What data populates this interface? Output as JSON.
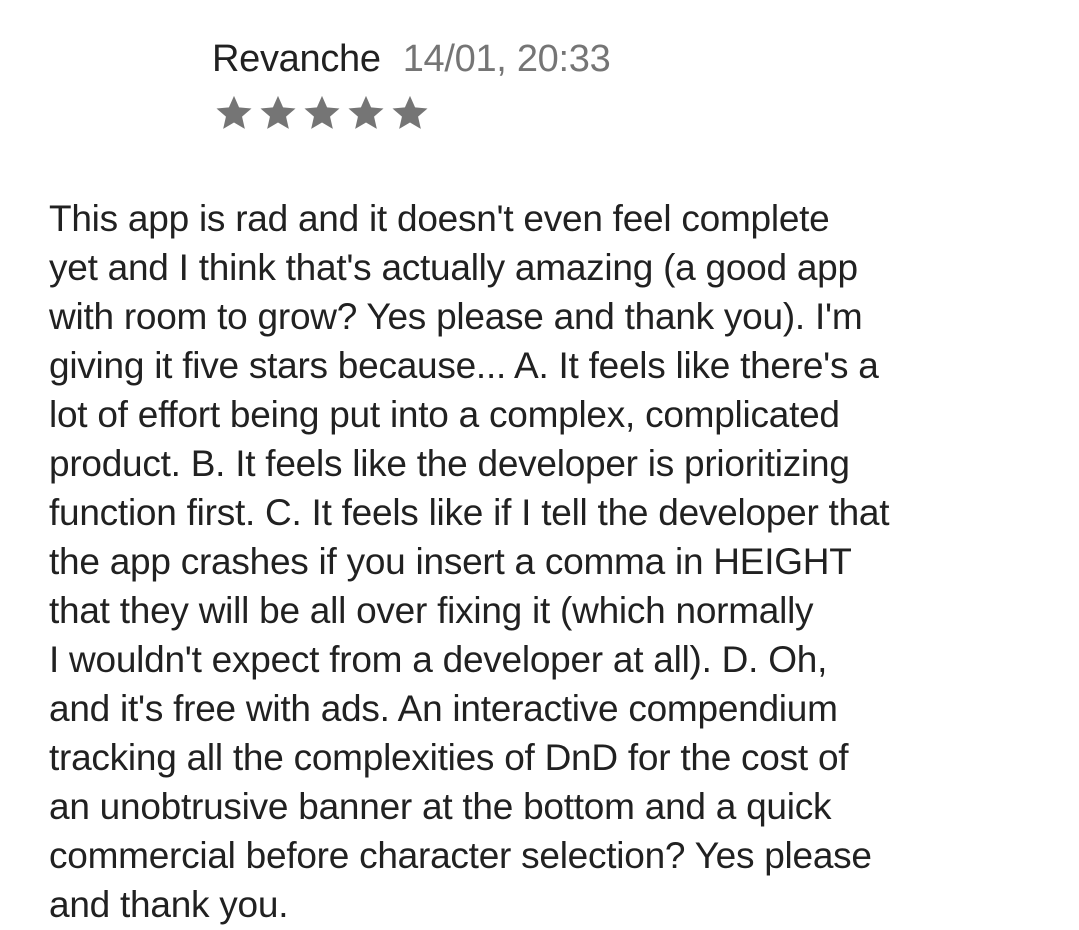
{
  "review": {
    "author": "Revanche",
    "date": "14/01, 20:33",
    "rating": 5,
    "rating_max": 5,
    "star_color": "#757575",
    "star_icon": "star-icon",
    "text_lines": [
      "This app is rad and it doesn't even feel complete",
      "yet and I think that's actually amazing (a good app",
      "with room to grow? Yes please and thank you). I'm",
      "giving it five stars because... A. It feels like there's a",
      "lot of effort being put into a complex, complicated",
      "product. B. It feels like the developer is prioritizing",
      "function first. C. It feels like if I tell the developer that",
      "the app crashes if you insert a comma in HEIGHT",
      "that they will be all over fixing it (which normally",
      "I wouldn't expect from a developer at all). D. Oh,",
      "and it's free with ads. An interactive compendium",
      "tracking all the complexities of DnD for the cost of",
      "an unobtrusive banner at the bottom and a quick",
      "commercial before character selection? Yes please",
      "and thank you."
    ]
  }
}
